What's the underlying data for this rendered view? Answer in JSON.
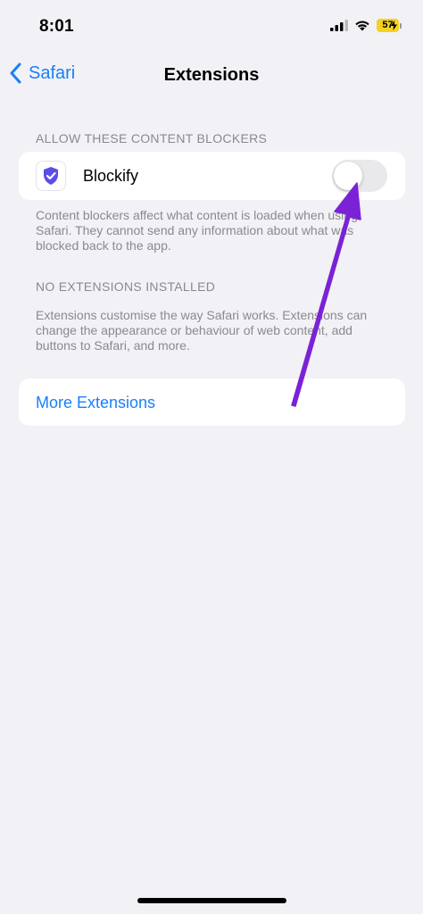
{
  "status_bar": {
    "time": "8:01",
    "battery": "57"
  },
  "nav": {
    "back_label": "Safari",
    "title": "Extensions"
  },
  "content_blockers": {
    "header": "ALLOW THESE CONTENT BLOCKERS",
    "items": [
      {
        "label": "Blockify",
        "enabled": false,
        "icon": "shield-check-icon"
      }
    ],
    "footer": "Content blockers affect what content is loaded when using Safari. They cannot send any information about what was blocked back to the app."
  },
  "extensions": {
    "header": "NO EXTENSIONS INSTALLED",
    "footer": "Extensions customise the way Safari works. Extensions can change the appearance or behaviour of web content, add buttons to Safari, and more."
  },
  "more_extensions": {
    "label": "More Extensions"
  },
  "colors": {
    "accent": "#1a7ff7",
    "arrow": "#7b22d6",
    "app_icon": "#5b4ee8",
    "battery": "#f5d21e"
  }
}
